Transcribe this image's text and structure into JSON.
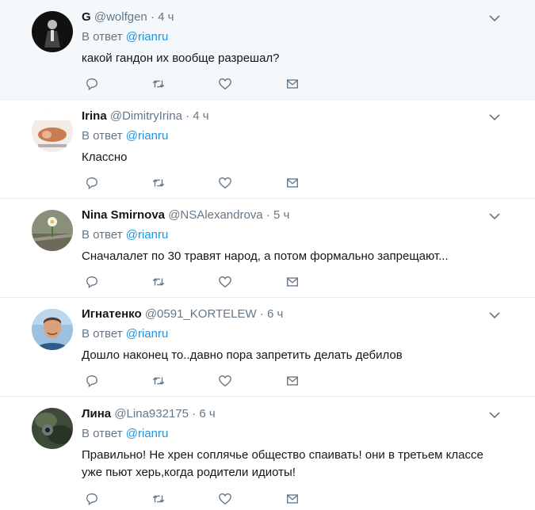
{
  "colors": {
    "name": "#14171a",
    "secondary": "#657786",
    "link": "#1b95e0",
    "highlight_bg": "#f5f8fa",
    "divider": "#e6ecf0"
  },
  "tweets": [
    {
      "name": "G",
      "handle": "@wolfgen",
      "dot": "·",
      "time": "4 ч",
      "reply_prefix": "В ответ",
      "reply_mention": "@rianru",
      "text": "какой гандон их вообще разрешал?"
    },
    {
      "name": "Irina",
      "handle": "@DimitryIrina",
      "dot": "·",
      "time": "4 ч",
      "reply_prefix": "В ответ",
      "reply_mention": "@rianru",
      "text": "Классно"
    },
    {
      "name": "Nina Smirnova",
      "handle": "@NSAlexandrova",
      "dot": "·",
      "time": "5 ч",
      "reply_prefix": "В ответ",
      "reply_mention": "@rianru",
      "text": "Сначалалет по 30 травят народ, а потом формально запрещают..."
    },
    {
      "name": "Игнатенко",
      "handle": "@0591_KORTELEW",
      "dot": "·",
      "time": "6 ч",
      "reply_prefix": "В ответ",
      "reply_mention": "@rianru",
      "text": "Дошло наконец то..давно пора запретить делать дебилов"
    },
    {
      "name": "Лина",
      "handle": "@Lina932175",
      "dot": "·",
      "time": "6 ч",
      "reply_prefix": "В ответ",
      "reply_mention": "@rianru",
      "text": "Правильно! Не хрен соплячье общество спаивать! они в третьем классе уже пьют херь,когда родители идиоты!"
    }
  ],
  "icons": {
    "reply": "reply-icon",
    "retweet": "retweet-icon",
    "like": "heart-icon",
    "dm": "envelope-icon",
    "menu": "chevron-down-icon"
  }
}
